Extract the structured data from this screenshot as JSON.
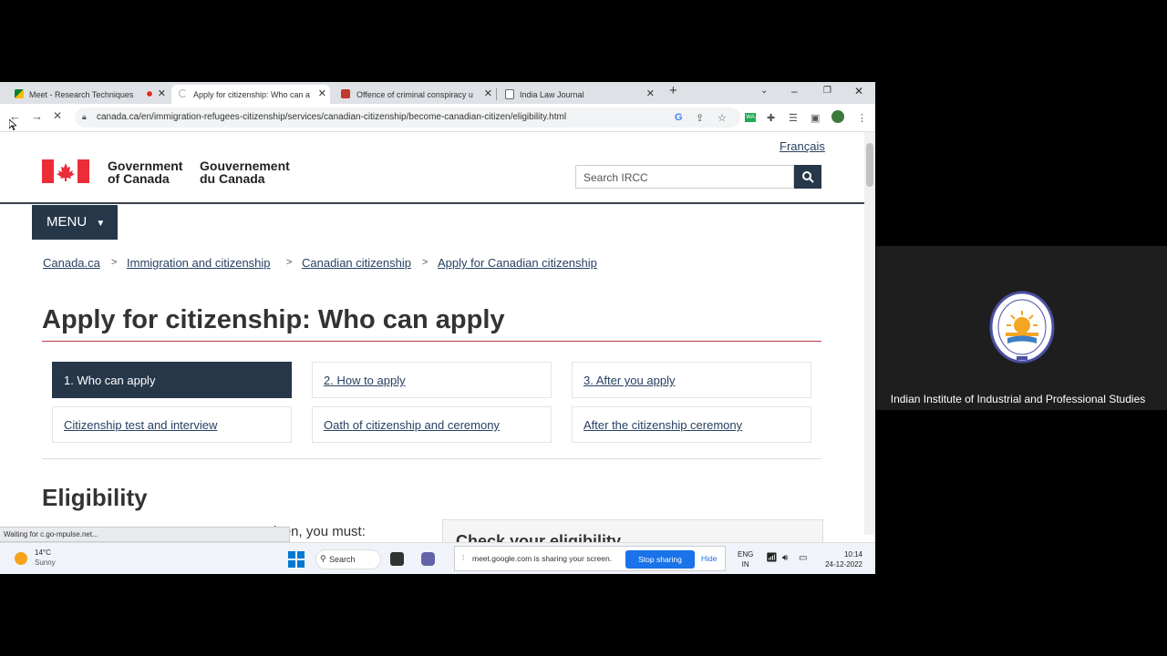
{
  "browser": {
    "tabs": [
      {
        "title": "Meet - Research Techniques",
        "active": false,
        "recording": true
      },
      {
        "title": "Apply for citizenship: Who can a",
        "active": true,
        "recording": false
      },
      {
        "title": "Offence of criminal conspiracy u",
        "active": false,
        "recording": false
      },
      {
        "title": "India Law Journal",
        "active": false,
        "recording": false
      }
    ],
    "new_tab": "+",
    "url": "canada.ca/en/immigration-refugees-citizenship/services/canadian-citizenship/become-canadian-citizen/eligibility.html",
    "status": "Waiting for c.go-mpulse.net..."
  },
  "page": {
    "language_link": "Français",
    "gov_en_line1": "Government",
    "gov_en_line2": "of Canada",
    "gov_fr_line1": "Gouvernement",
    "gov_fr_line2": "du Canada",
    "search_placeholder": "Search IRCC",
    "menu_label": "MENU",
    "breadcrumbs": [
      "Canada.ca",
      "Immigration and citizenship",
      "Canadian citizenship",
      "Apply for Canadian citizenship"
    ],
    "title": "Apply for citizenship: Who can apply",
    "steps": [
      {
        "label": "1. Who can apply",
        "active": true
      },
      {
        "label": "2. How to apply",
        "active": false
      },
      {
        "label": "3. After you apply",
        "active": false
      },
      {
        "label": "Citizenship test and interview",
        "active": false
      },
      {
        "label": "Oath of citizenship and ceremony",
        "active": false
      },
      {
        "label": "After the citizenship ceremony",
        "active": false
      }
    ],
    "section_title": "Eligibility",
    "intro_visible": "izen, you must:",
    "side_panel_title": "Check your eligibility"
  },
  "taskbar": {
    "weather_temp": "14°C",
    "weather_cond": "Sunny",
    "search_label": "Search",
    "share_text": "meet.google.com is sharing your screen.",
    "stop_sharing": "Stop sharing",
    "hide": "Hide",
    "lang_top": "ENG",
    "lang_bottom": "IN",
    "time": "10:14",
    "date": "24-12-2022"
  },
  "meet_tile": {
    "participant_name": "Indian Institute of Industrial and Professional Studies"
  },
  "colors": {
    "gc_navy": "#26374a",
    "link": "#284162",
    "flag_red": "#eb2d37",
    "accent_red": "#af3c43",
    "meet_blue": "#1a73e8"
  }
}
